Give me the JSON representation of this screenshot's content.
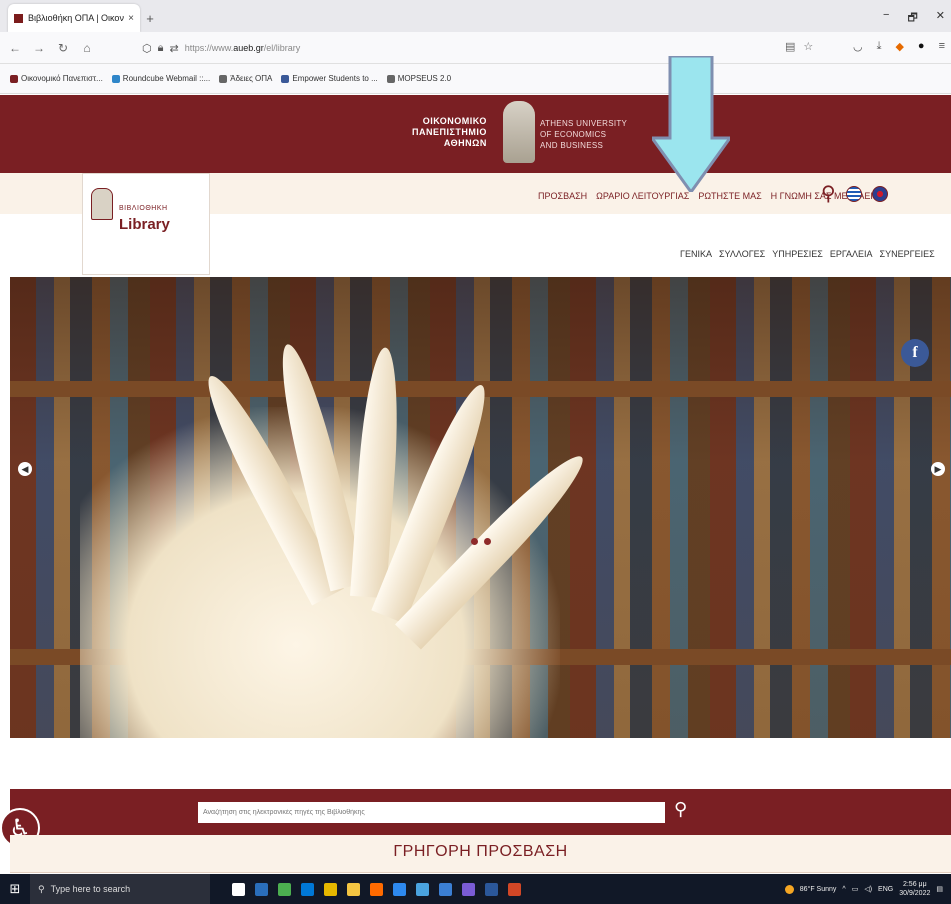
{
  "browser": {
    "tab_title": "Βιβλιοθήκη ΟΠΑ | Οικονομικό",
    "tab_close": "×",
    "new_tab": "+",
    "url_prefix": "https://www.",
    "url_domain": "aueb.gr",
    "url_path": "/el/library",
    "window_controls": {
      "minimize": "−",
      "restore": "🗗",
      "close": "✕"
    }
  },
  "bookmarks": [
    {
      "label": "Οικονομικό Πανεπιστ...",
      "color": "#7a1f23"
    },
    {
      "label": "Roundcube Webmail ::...",
      "color": "#2f86c9"
    },
    {
      "label": "Άδειες ΟΠΑ",
      "color": "#666666"
    },
    {
      "label": "Empower Students to ...",
      "color": "#3b5998"
    },
    {
      "label": "MOPSEUS 2.0",
      "color": "#666666"
    }
  ],
  "header": {
    "uni_gr": [
      "ΟΙΚΟΝΟΜΙΚΟ",
      "ΠΑΝΕΠΙΣΤΗΜΙΟ",
      "ΑΘΗΝΩΝ"
    ],
    "uni_en": [
      "ATHENS UNIVERSITY",
      "OF ECONOMICS",
      "AND BUSINESS"
    ],
    "library_small": "ΒΙΒΛΙΟΘΗΚΗ",
    "library_big": "Library"
  },
  "utility_nav": [
    "ΠΡΟΣΒΑΣΗ",
    "ΩΡΑΡΙΟ ΛΕΙΤΟΥΡΓΙΑΣ",
    "ΡΩΤΗΣΤΕ ΜΑΣ",
    "Η ΓΝΩΜΗ ΣΑΣ ΜΕΤΡΑΕΙ"
  ],
  "main_nav": [
    "ΓΕΝΙΚΑ",
    "ΣΥΛΛΟΓΕΣ",
    "ΥΠΗΡΕΣΙΕΣ",
    "ΕΡΓΑΛΕΙΑ",
    "ΣΥΝΕΡΓΕΙΕΣ"
  ],
  "hero": {
    "facebook_label": "f",
    "slides_total": 2
  },
  "search": {
    "placeholder": "Αναζήτηση στις ηλεκτρονικές πηγές της Βιβλιοθήκης"
  },
  "quick_access": {
    "title": "ΓΡΗΓΟΡΗ ΠΡΟΣΒΑΣΗ"
  },
  "taskbar": {
    "search_placeholder": "Type here to search",
    "weather": "86°F Sunny",
    "lang": "ENG",
    "time": "2:56 μμ",
    "date": "30/9/2022",
    "apps": [
      "#ffffff",
      "#2a6ebb",
      "#4caf50",
      "#0078d7",
      "#e6b800",
      "#f4c542",
      "#ff6a00",
      "#2d89ef",
      "#4aa3df",
      "#3b7fd4",
      "#7a5cd6",
      "#2b579a",
      "#d24726"
    ]
  },
  "colors": {
    "brand": "#7a1f23",
    "cream": "#faf2e8",
    "arrow": "#9be5ee"
  }
}
